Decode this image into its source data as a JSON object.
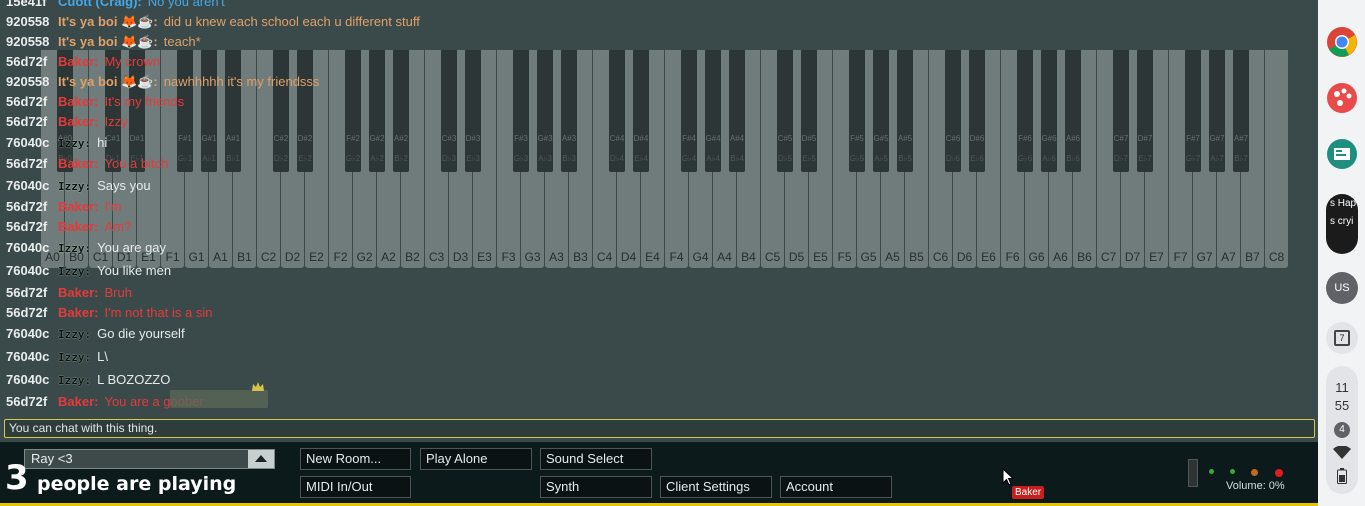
{
  "piano": {
    "white_keys": [
      "A0",
      "B0",
      "C1",
      "D1",
      "E1",
      "F1",
      "G1",
      "A1",
      "B1",
      "C2",
      "D2",
      "E2",
      "F2",
      "G2",
      "A2",
      "B2",
      "C3",
      "D3",
      "E3",
      "F3",
      "G3",
      "A3",
      "B3",
      "C4",
      "D4",
      "E4",
      "F4",
      "G4",
      "A4",
      "B4",
      "C5",
      "D5",
      "E5",
      "F5",
      "G5",
      "A5",
      "B5",
      "C6",
      "D6",
      "E6",
      "F6",
      "G6",
      "A6",
      "B6",
      "C7",
      "D7",
      "E7",
      "F7",
      "G7",
      "A7",
      "B7",
      "C8"
    ],
    "black_keys": [
      {
        "sharp": "A#0",
        "flat": "B♭0"
      },
      {
        "sharp": "C#1",
        "flat": "D♭1"
      },
      {
        "sharp": "D#1",
        "flat": "E♭1"
      },
      {
        "sharp": "F#1",
        "flat": "G♭1"
      },
      {
        "sharp": "G#1",
        "flat": "A♭1"
      },
      {
        "sharp": "A#1",
        "flat": "B♭1"
      },
      {
        "sharp": "C#2",
        "flat": "D♭2"
      },
      {
        "sharp": "D#2",
        "flat": "E♭2"
      },
      {
        "sharp": "F#2",
        "flat": "G♭2"
      },
      {
        "sharp": "G#2",
        "flat": "A♭2"
      },
      {
        "sharp": "A#2",
        "flat": "B♭2"
      },
      {
        "sharp": "C#3",
        "flat": "D♭3"
      },
      {
        "sharp": "D#3",
        "flat": "E♭3"
      },
      {
        "sharp": "F#3",
        "flat": "G♭3"
      },
      {
        "sharp": "G#3",
        "flat": "A♭3"
      },
      {
        "sharp": "A#3",
        "flat": "B♭3"
      },
      {
        "sharp": "C#4",
        "flat": "D♭4"
      },
      {
        "sharp": "D#4",
        "flat": "E♭4"
      },
      {
        "sharp": "F#4",
        "flat": "G♭4"
      },
      {
        "sharp": "G#4",
        "flat": "A♭4"
      },
      {
        "sharp": "A#4",
        "flat": "B♭4"
      },
      {
        "sharp": "C#5",
        "flat": "D♭5"
      },
      {
        "sharp": "D#5",
        "flat": "E♭5"
      },
      {
        "sharp": "F#5",
        "flat": "G♭5"
      },
      {
        "sharp": "G#5",
        "flat": "A♭5"
      },
      {
        "sharp": "A#5",
        "flat": "B♭5"
      },
      {
        "sharp": "C#6",
        "flat": "D♭6"
      },
      {
        "sharp": "D#6",
        "flat": "E♭6"
      },
      {
        "sharp": "F#6",
        "flat": "G♭6"
      },
      {
        "sharp": "G#6",
        "flat": "A♭6"
      },
      {
        "sharp": "A#6",
        "flat": "B♭6"
      },
      {
        "sharp": "C#7",
        "flat": "D♭7"
      },
      {
        "sharp": "D#7",
        "flat": "E♭7"
      },
      {
        "sharp": "F#7",
        "flat": "G♭7"
      },
      {
        "sharp": "G#7",
        "flat": "A♭7"
      },
      {
        "sharp": "A#7",
        "flat": "B♭7"
      }
    ]
  },
  "chat": {
    "messages": [
      {
        "id": "15e41f",
        "name": "Cuott (Craig):",
        "text": "No you aren't",
        "style": "craig"
      },
      {
        "id": "920558",
        "name": "It's ya boi 🦊☕:",
        "text": "did u knew each school each u different stuff",
        "style": "yabo"
      },
      {
        "id": "920558",
        "name": "It's ya boi 🦊☕:",
        "text": "teach*",
        "style": "yabo"
      },
      {
        "id": "56d72f",
        "name": "Baker:",
        "text": "My crown",
        "style": "baker"
      },
      {
        "id": "920558",
        "name": "It's ya boi 🦊☕:",
        "text": "nawhhhhh it's my friendsss",
        "style": "yabo"
      },
      {
        "id": "56d72f",
        "name": "Baker:",
        "text": "It's my friends",
        "style": "baker"
      },
      {
        "id": "56d72f",
        "name": "Baker:",
        "text": "Izzy",
        "style": "baker"
      },
      {
        "id": "76040c",
        "name": "Izzy:",
        "text": "hi",
        "style": "izzy"
      },
      {
        "id": "56d72f",
        "name": "Baker:",
        "text": "You a bitch",
        "style": "baker"
      },
      {
        "id": "76040c",
        "name": "Izzy:",
        "text": "Says you",
        "style": "izzy"
      },
      {
        "id": "56d72f",
        "name": "Baker:",
        "text": "I'm",
        "style": "baker"
      },
      {
        "id": "56d72f",
        "name": "Baker:",
        "text": "Am?",
        "style": "baker"
      },
      {
        "id": "76040c",
        "name": "Izzy:",
        "text": "You are gay",
        "style": "izzy"
      },
      {
        "id": "76040c",
        "name": "Izzy:",
        "text": "You like men",
        "style": "izzy"
      },
      {
        "id": "56d72f",
        "name": "Baker:",
        "text": "Bruh",
        "style": "baker"
      },
      {
        "id": "56d72f",
        "name": "Baker:",
        "text": "I'm not that is a sin",
        "style": "baker"
      },
      {
        "id": "76040c",
        "name": "Izzy:",
        "text": "Go die yourself",
        "style": "izzy"
      },
      {
        "id": "76040c",
        "name": "Izzy:",
        "text": "L\\",
        "style": "izzy"
      },
      {
        "id": "76040c",
        "name": "Izzy:",
        "text": "L BOZOZZO",
        "style": "izzy"
      },
      {
        "id": "56d72f",
        "name": "Baker:",
        "text": "You are a goober",
        "style": "baker"
      }
    ],
    "input_placeholder": "You can chat with this thing."
  },
  "colors": {
    "baker": "#e63a3a",
    "yabo": "#e0a06a",
    "craig": "#45a8e8",
    "izzy": "#111111",
    "accent": "#e5c400"
  },
  "bottom": {
    "room_name": "Ray <3",
    "player_count": "3",
    "player_text": "people are playing",
    "buttons": {
      "new_room": "New Room...",
      "play_alone": "Play Alone",
      "sound_select": "Sound Select",
      "midi": "MIDI In/Out",
      "synth": "Synth",
      "client_settings": "Client Settings",
      "account": "Account"
    },
    "volume_label": "Volume: 0%",
    "cursor_tag": "Baker"
  },
  "shelf": {
    "icons": [
      "chrome-icon",
      "palette-icon",
      "classroom-icon",
      "avatar-icon",
      "user-locale-icon",
      "calendar-icon"
    ],
    "avatar_text_1": "s Hap",
    "avatar_text_2": "s cryi",
    "locale": "US",
    "calendar_day": "7",
    "clock_hour": "11",
    "clock_min": "55",
    "notif_count": "4"
  }
}
